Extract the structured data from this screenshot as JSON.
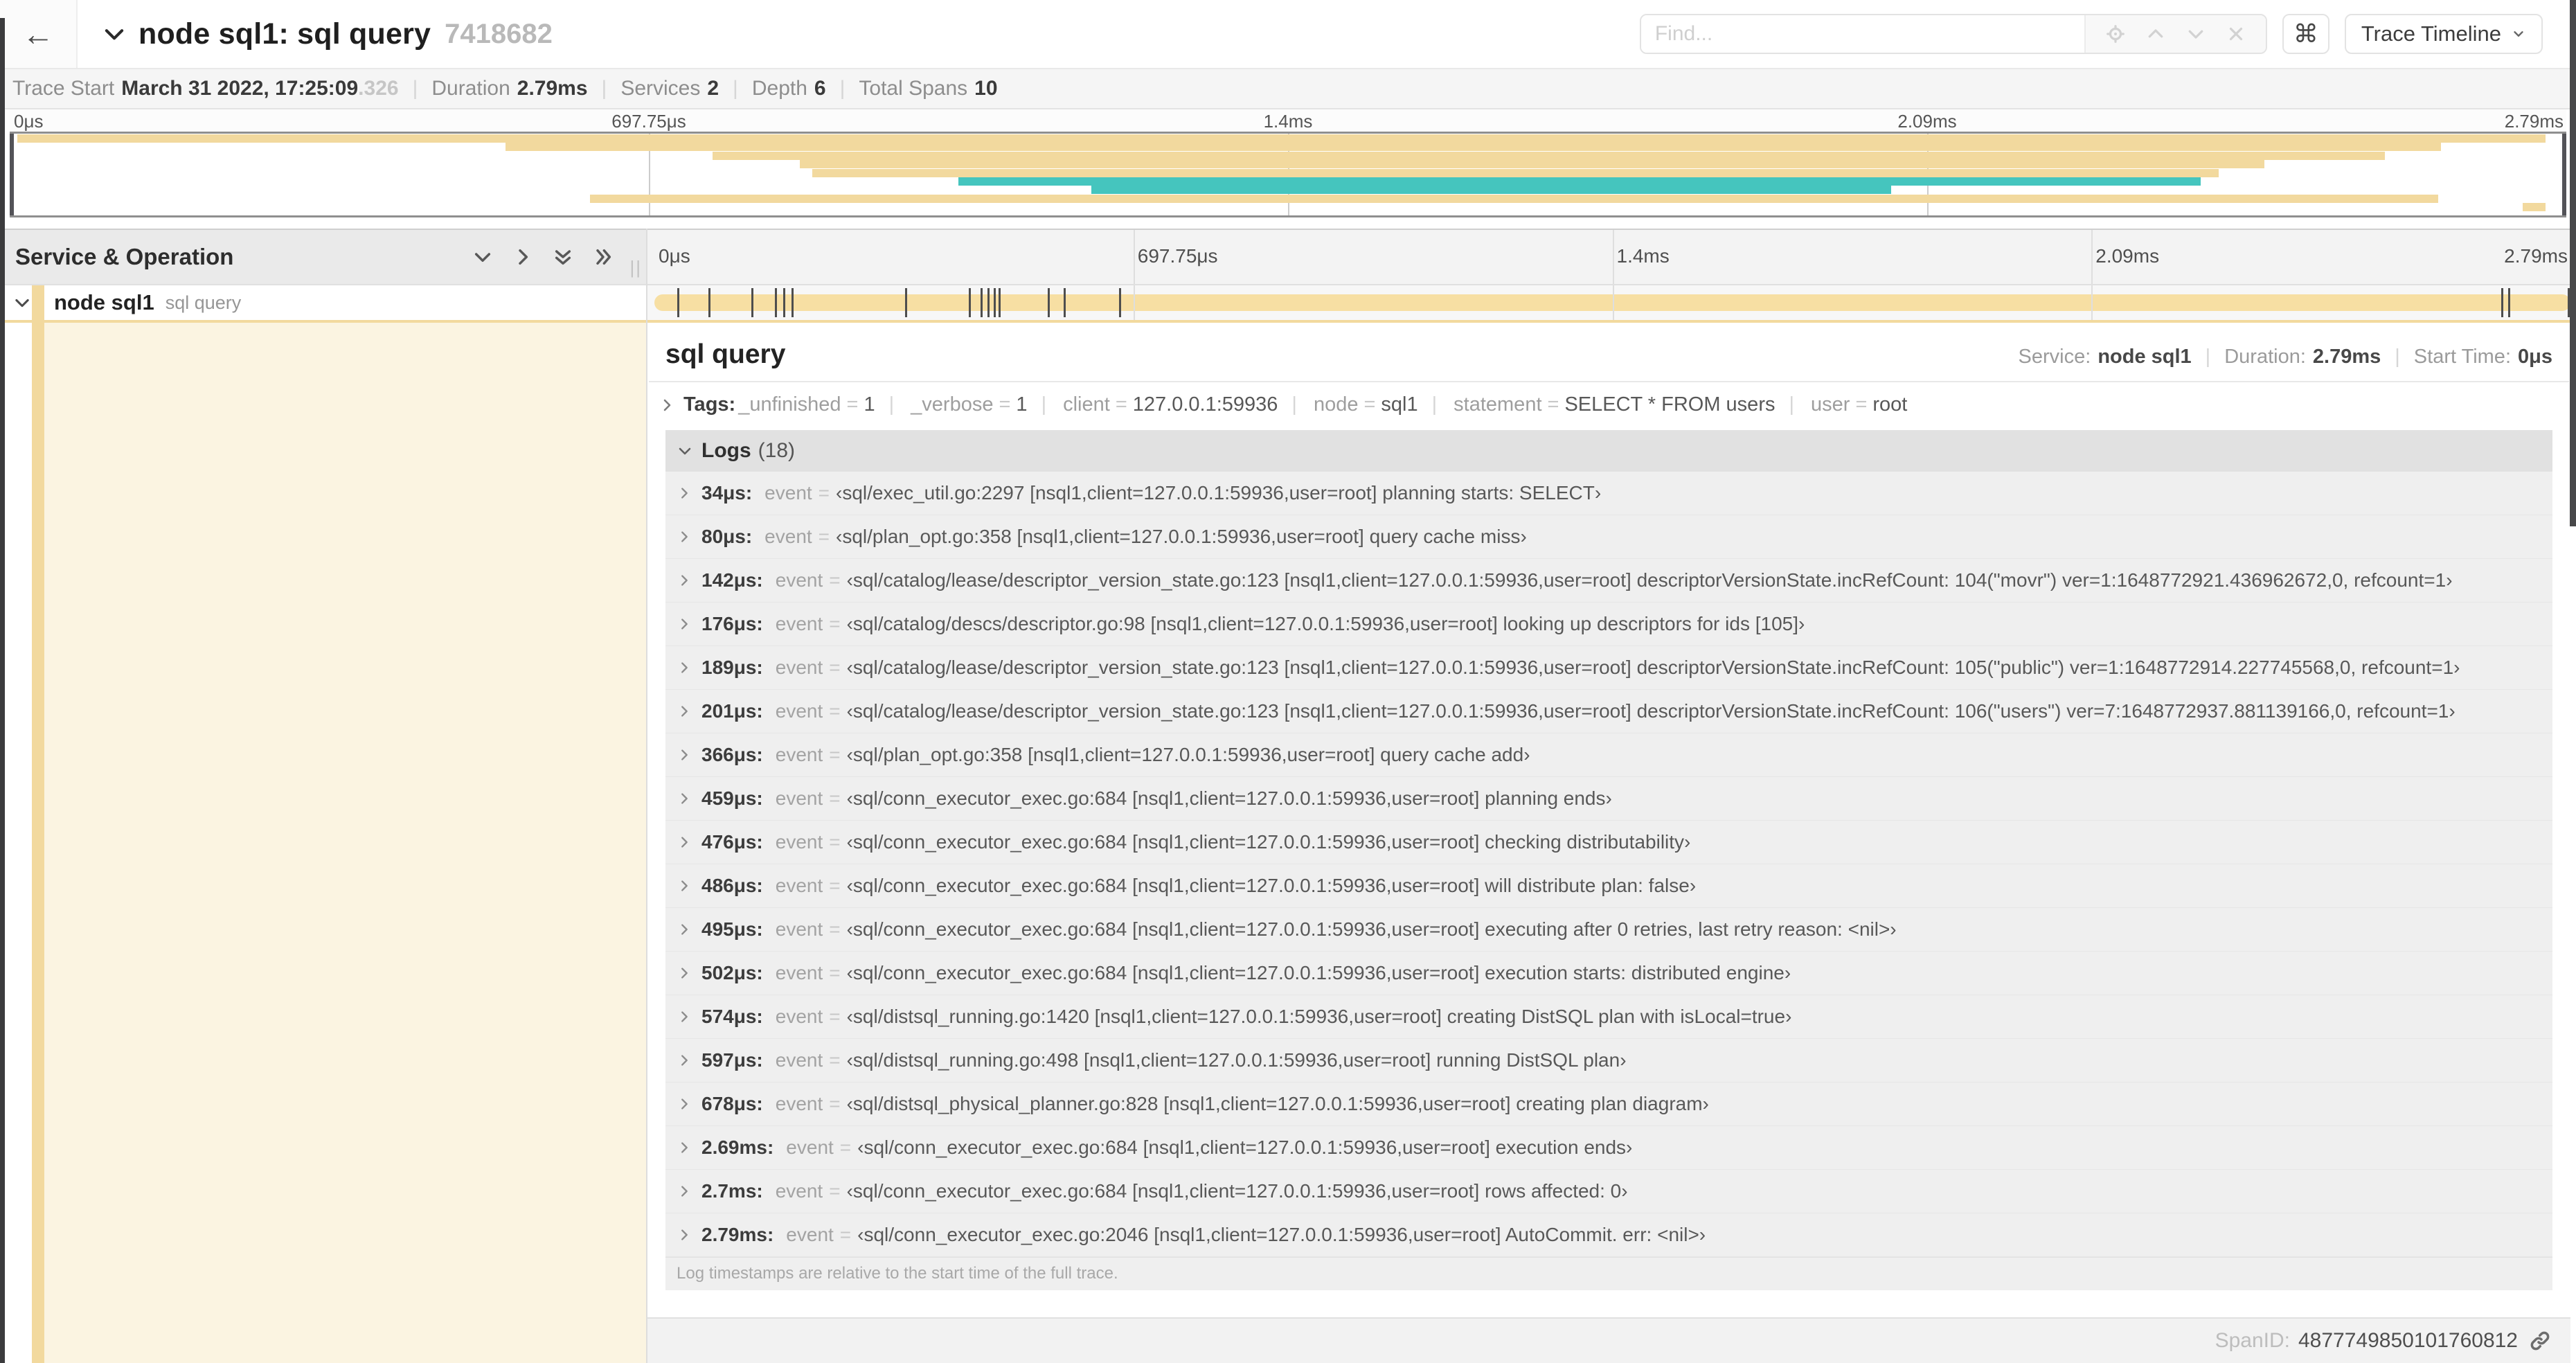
{
  "header": {
    "back_icon": "←",
    "title": "node sql1: sql query",
    "trace_id": "7418682",
    "find_placeholder": "Find...",
    "command_icon": "⌘",
    "view_selector": "Trace Timeline"
  },
  "trace_info": {
    "items": [
      {
        "label": "Trace Start",
        "value": "March 31 2022, 17:25:09",
        "suffix": ".326"
      },
      {
        "label": "Duration",
        "value": "2.79ms",
        "suffix": ""
      },
      {
        "label": "Services",
        "value": "2",
        "suffix": ""
      },
      {
        "label": "Depth",
        "value": "6",
        "suffix": ""
      },
      {
        "label": "Total Spans",
        "value": "10",
        "suffix": ""
      }
    ]
  },
  "minimap": {
    "ticks": [
      {
        "label": "0μs",
        "pct": 0
      },
      {
        "label": "697.75μs",
        "pct": 25
      },
      {
        "label": "1.4ms",
        "pct": 50
      },
      {
        "label": "2.09ms",
        "pct": 75
      },
      {
        "label": "2.79ms",
        "pct": 100
      }
    ],
    "grid_pcts": [
      25,
      50,
      75
    ],
    "spans": [
      {
        "row": 0,
        "start": 0.3,
        "end": 99.2,
        "color": "tan"
      },
      {
        "row": 1,
        "start": 19.4,
        "end": 95.1,
        "color": "tan"
      },
      {
        "row": 2,
        "start": 27.5,
        "end": 92.9,
        "color": "tan"
      },
      {
        "row": 3,
        "start": 30.9,
        "end": 88.2,
        "color": "tan"
      },
      {
        "row": 4,
        "start": 31.4,
        "end": 86.4,
        "color": "tan"
      },
      {
        "row": 5,
        "start": 37.1,
        "end": 85.7,
        "color": "teal"
      },
      {
        "row": 6,
        "start": 42.3,
        "end": 73.6,
        "color": "teal"
      },
      {
        "row": 7,
        "start": 22.7,
        "end": 95.0,
        "color": "tan"
      },
      {
        "row": 8,
        "start": 98.3,
        "end": 99.2,
        "color": "tan"
      }
    ]
  },
  "timeline": {
    "left_header": "Service & Operation",
    "grip": "||",
    "ticks": [
      {
        "label": "0μs",
        "pct": 0
      },
      {
        "label": "697.75μs",
        "pct": 25
      },
      {
        "label": "1.4ms",
        "pct": 50
      },
      {
        "label": "2.09ms",
        "pct": 75
      },
      {
        "label": "2.79ms",
        "pct": 100
      }
    ],
    "grid_pcts": [
      25,
      50,
      75
    ],
    "row": {
      "service": "node sql1",
      "operation": "sql query"
    }
  },
  "detail": {
    "operation": "sql query",
    "duration_ms": 2.79,
    "meta": [
      {
        "label": "Service:",
        "value": "node sql1"
      },
      {
        "label": "Duration:",
        "value": "2.79ms"
      },
      {
        "label": "Start Time:",
        "value": "0μs"
      }
    ],
    "tags_label": "Tags:",
    "tags": [
      {
        "key": "_unfinished",
        "value": "1"
      },
      {
        "key": "_verbose",
        "value": "1"
      },
      {
        "key": "client",
        "value": "127.0.0.1:59936"
      },
      {
        "key": "node",
        "value": "sql1"
      },
      {
        "key": "statement",
        "value": "SELECT * FROM users"
      },
      {
        "key": "user",
        "value": "root"
      }
    ],
    "logs_label": "Logs",
    "logs_count": "(18)",
    "logs": [
      {
        "ts": "34μs:",
        "ms": 0.034,
        "field": "event",
        "value": "‹sql/exec_util.go:2297 [nsql1,client=127.0.0.1:59936,user=root] planning starts: SELECT›"
      },
      {
        "ts": "80μs:",
        "ms": 0.08,
        "field": "event",
        "value": "‹sql/plan_opt.go:358 [nsql1,client=127.0.0.1:59936,user=root] query cache miss›"
      },
      {
        "ts": "142μs:",
        "ms": 0.142,
        "field": "event",
        "value": "‹sql/catalog/lease/descriptor_version_state.go:123 [nsql1,client=127.0.0.1:59936,user=root] descriptorVersionState.incRefCount: 104(\"movr\") ver=1:1648772921.436962672,0, refcount=1›"
      },
      {
        "ts": "176μs:",
        "ms": 0.176,
        "field": "event",
        "value": "‹sql/catalog/descs/descriptor.go:98 [nsql1,client=127.0.0.1:59936,user=root] looking up descriptors for ids [105]›"
      },
      {
        "ts": "189μs:",
        "ms": 0.189,
        "field": "event",
        "value": "‹sql/catalog/lease/descriptor_version_state.go:123 [nsql1,client=127.0.0.1:59936,user=root] descriptorVersionState.incRefCount: 105(\"public\") ver=1:1648772914.227745568,0, refcount=1›"
      },
      {
        "ts": "201μs:",
        "ms": 0.201,
        "field": "event",
        "value": "‹sql/catalog/lease/descriptor_version_state.go:123 [nsql1,client=127.0.0.1:59936,user=root] descriptorVersionState.incRefCount: 106(\"users\") ver=7:1648772937.881139166,0, refcount=1›"
      },
      {
        "ts": "366μs:",
        "ms": 0.366,
        "field": "event",
        "value": "‹sql/plan_opt.go:358 [nsql1,client=127.0.0.1:59936,user=root] query cache add›"
      },
      {
        "ts": "459μs:",
        "ms": 0.459,
        "field": "event",
        "value": "‹sql/conn_executor_exec.go:684 [nsql1,client=127.0.0.1:59936,user=root] planning ends›"
      },
      {
        "ts": "476μs:",
        "ms": 0.476,
        "field": "event",
        "value": "‹sql/conn_executor_exec.go:684 [nsql1,client=127.0.0.1:59936,user=root] checking distributability›"
      },
      {
        "ts": "486μs:",
        "ms": 0.486,
        "field": "event",
        "value": "‹sql/conn_executor_exec.go:684 [nsql1,client=127.0.0.1:59936,user=root] will distribute plan: false›"
      },
      {
        "ts": "495μs:",
        "ms": 0.495,
        "field": "event",
        "value": "‹sql/conn_executor_exec.go:684 [nsql1,client=127.0.0.1:59936,user=root] executing after 0 retries, last retry reason: <nil>›"
      },
      {
        "ts": "502μs:",
        "ms": 0.502,
        "field": "event",
        "value": "‹sql/conn_executor_exec.go:684 [nsql1,client=127.0.0.1:59936,user=root] execution starts: distributed engine›"
      },
      {
        "ts": "574μs:",
        "ms": 0.574,
        "field": "event",
        "value": "‹sql/distsql_running.go:1420 [nsql1,client=127.0.0.1:59936,user=root] creating DistSQL plan with isLocal=true›"
      },
      {
        "ts": "597μs:",
        "ms": 0.597,
        "field": "event",
        "value": "‹sql/distsql_running.go:498 [nsql1,client=127.0.0.1:59936,user=root] running DistSQL plan›"
      },
      {
        "ts": "678μs:",
        "ms": 0.678,
        "field": "event",
        "value": "‹sql/distsql_physical_planner.go:828 [nsql1,client=127.0.0.1:59936,user=root] creating plan diagram›"
      },
      {
        "ts": "2.69ms:",
        "ms": 2.69,
        "field": "event",
        "value": "‹sql/conn_executor_exec.go:684 [nsql1,client=127.0.0.1:59936,user=root] execution ends›"
      },
      {
        "ts": "2.7ms:",
        "ms": 2.7,
        "field": "event",
        "value": "‹sql/conn_executor_exec.go:684 [nsql1,client=127.0.0.1:59936,user=root] rows affected: 0›"
      },
      {
        "ts": "2.79ms:",
        "ms": 2.79,
        "field": "event",
        "value": "‹sql/conn_executor_exec.go:2046 [nsql1,client=127.0.0.1:59936,user=root] AutoCommit. err: <nil>›"
      }
    ],
    "note": "Log timestamps are relative to the start time of the full trace.",
    "span_id_label": "SpanID:",
    "span_id": "4877749850101760812"
  },
  "symbols": {
    "sep": "|",
    "eq": "="
  },
  "colors": {
    "tan": "#F2D99E",
    "teal": "#45C5BE",
    "span_bar": "#F7DFA3",
    "cream": "#FBF4E1"
  }
}
